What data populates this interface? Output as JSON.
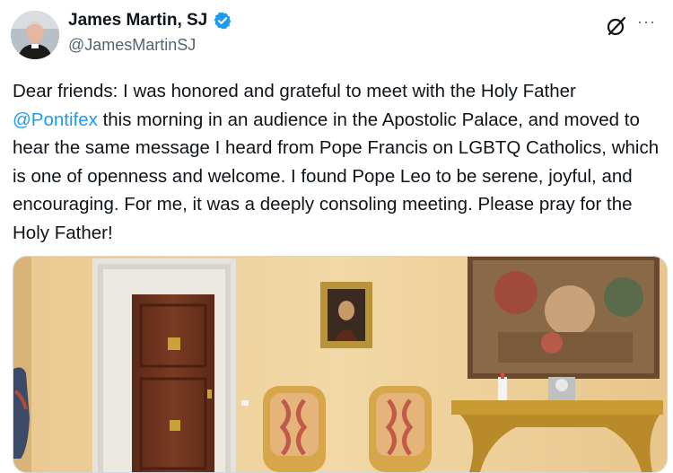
{
  "author": {
    "display_name": "James Martin, SJ",
    "handle": "@JamesMartinSJ",
    "verified": true,
    "avatar_icon": "avatar-portrait"
  },
  "header_actions": {
    "grok_icon": "grok-icon",
    "more_label": "···"
  },
  "tweet": {
    "text_1": "Dear friends: I was honored and grateful to meet with the Holy Father ",
    "mention": "@Pontifex",
    "text_2": " this morning in an audience in the Apostolic Palace, and moved to hear the same message I heard from Pope Francis on LGBTQ Catholics, which is one of openness and welcome. I found Pope Leo to be serene, joyful, and encouraging. For me, it was a deeply consoling meeting. Please pray for the Holy Father!"
  },
  "colors": {
    "link": "#1d9bf0",
    "verified": "#1d9bf0",
    "secondary_text": "#536471"
  }
}
